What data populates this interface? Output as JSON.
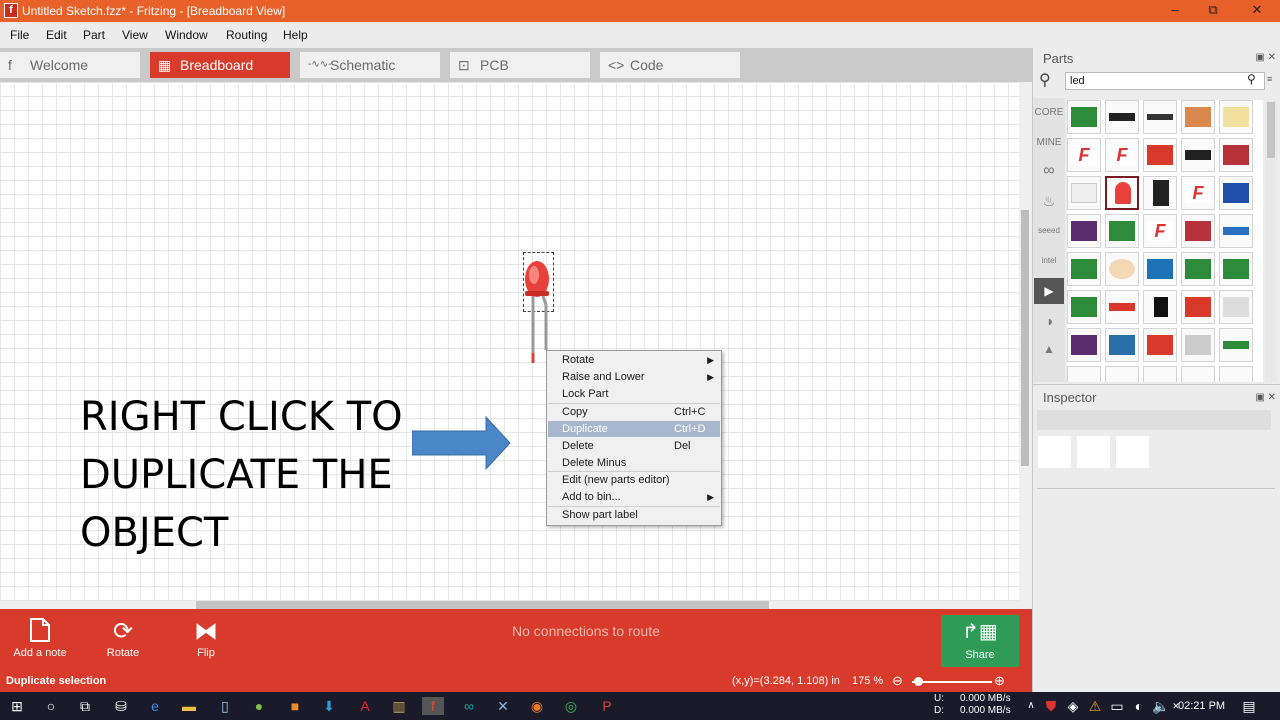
{
  "window": {
    "title": "Untitled Sketch.fzz* - Fritzing - [Breadboard View]",
    "controls": [
      "–",
      "⧉",
      "✕"
    ]
  },
  "menu": [
    "File",
    "Edit",
    "Part",
    "View",
    "Window",
    "Routing",
    "Help"
  ],
  "tabs": [
    {
      "label": "Welcome",
      "icon": "fritzing-f-icon",
      "glyph": "f",
      "active": false
    },
    {
      "label": "Breadboard",
      "icon": "breadboard-icon",
      "glyph": "▦",
      "active": true
    },
    {
      "label": "Schematic",
      "icon": "resistor-icon",
      "glyph": "-∿∿-",
      "active": false
    },
    {
      "label": "PCB",
      "icon": "pcb-icon",
      "glyph": "⊡",
      "active": false
    },
    {
      "label": "Code",
      "icon": "code-icon",
      "glyph": "<>",
      "active": false
    }
  ],
  "canvas": {
    "instruction": [
      "RIGHT CLICK TO",
      "DUPLICATE THE",
      "OBJECT"
    ],
    "brand": "fritzing"
  },
  "context_menu": {
    "items": [
      {
        "label": "Rotate",
        "shortcut": "",
        "submenu": true
      },
      {
        "label": "Raise and Lower",
        "shortcut": "",
        "submenu": true
      },
      {
        "label": "Lock Part",
        "shortcut": "",
        "submenu": false
      },
      {
        "label": "Copy",
        "shortcut": "Ctrl+C",
        "submenu": false
      },
      {
        "label": "Duplicate",
        "shortcut": "Ctrl+D",
        "submenu": false,
        "highlighted": true
      },
      {
        "label": "Delete",
        "shortcut": "Del",
        "submenu": false
      },
      {
        "label": "Delete Minus",
        "shortcut": "",
        "submenu": false
      },
      {
        "label": "Edit (new parts editor)",
        "shortcut": "",
        "submenu": false
      },
      {
        "label": "Add to bin...",
        "shortcut": "",
        "submenu": true
      },
      {
        "label": "Show part label",
        "shortcut": "",
        "submenu": false
      }
    ]
  },
  "toolbar": {
    "add_note": "Add a note",
    "rotate": "Rotate",
    "flip": "Flip",
    "routing_status": "No connections to route",
    "share": "Share"
  },
  "status": {
    "message": "Duplicate selection",
    "coords": "(x,y)=(3.284, 1.108) in",
    "zoom": "175 %"
  },
  "parts_panel": {
    "title": "Parts",
    "search_value": "led",
    "bins": [
      "CORE",
      "MINE"
    ]
  },
  "inspector": {
    "title": "Inspector"
  },
  "taskbar": {
    "net_up": "U:",
    "net_down": "D:",
    "up_rate": "0.000 MB/s",
    "down_rate": "0.000 MB/s",
    "time": "02:21 PM"
  },
  "colors": {
    "accent": "#d83b2b",
    "title_bar": "#e8602a",
    "share_green": "#2e9c56",
    "arrow_blue": "#4a86c8",
    "menu_highlight": "#a7b7cd"
  }
}
